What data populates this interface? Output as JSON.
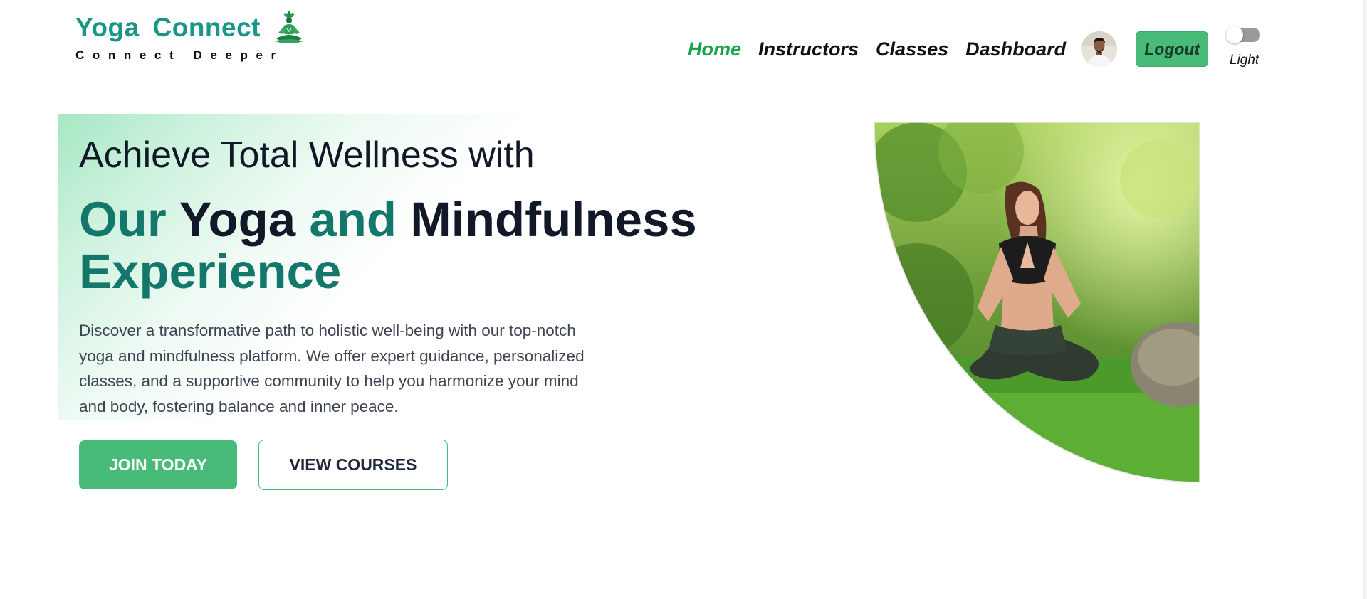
{
  "brand": {
    "title": "Yoga Connect",
    "tagline": "Connect Deeper",
    "logo_icon": "meditating-figure-icon",
    "color": "#1a9688"
  },
  "nav": {
    "items": [
      {
        "label": "Home",
        "active": true
      },
      {
        "label": "Instructors",
        "active": false
      },
      {
        "label": "Classes",
        "active": false
      },
      {
        "label": "Dashboard",
        "active": false
      }
    ],
    "active_color": "#18a34a",
    "avatar_icon": "user-avatar",
    "logout_label": "Logout"
  },
  "theme_toggle": {
    "label": "Light",
    "state": "off"
  },
  "hero": {
    "line1": "Achieve Total Wellness with",
    "line2_parts": {
      "our": "Our",
      "yoga": "Yoga",
      "and": "and",
      "mindfulness": "Mindfulness",
      "experience": "Experience"
    },
    "description": "Discover a transformative path to holistic well-being with our top-notch yoga and mindfulness platform. We offer expert guidance, personalized classes, and a supportive community to help you harmonize your mind and body, fostering balance and inner peace.",
    "join_label": "JOIN TODAY",
    "view_label": "VIEW COURSES",
    "image_icon": "yoga-woman-meditating-photo",
    "accent_color": "#14776c",
    "button_color": "#48bb78"
  }
}
